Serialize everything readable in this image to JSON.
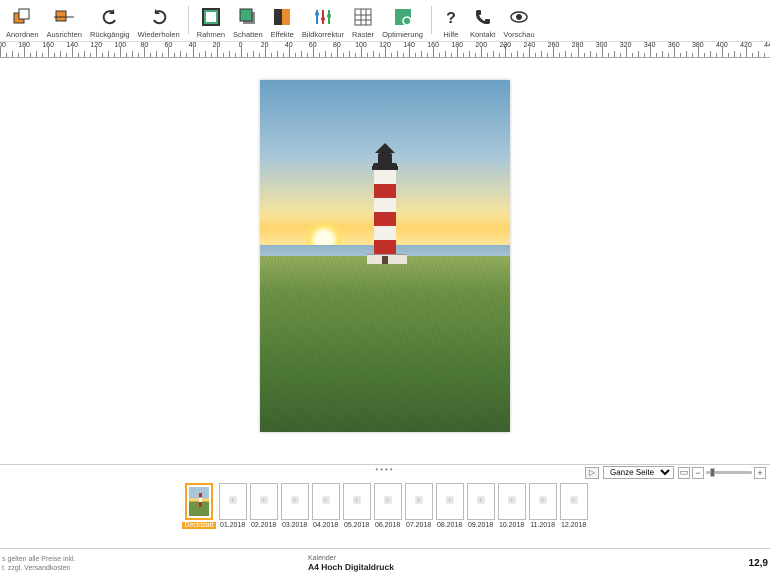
{
  "toolbar": {
    "items": [
      {
        "id": "anordnen",
        "label": "Anordnen",
        "icon": "arrange-icon",
        "color": "#e98b2e"
      },
      {
        "id": "ausrichten",
        "label": "Ausrichten",
        "icon": "align-icon",
        "color": "#e98b2e"
      },
      {
        "id": "rueckgaengig",
        "label": "Rückgängig",
        "icon": "undo-icon",
        "color": "#333"
      },
      {
        "id": "wiederholen",
        "label": "Wiederholen",
        "icon": "redo-icon",
        "color": "#333",
        "sep_after": true
      },
      {
        "id": "rahmen",
        "label": "Rahmen",
        "icon": "frame-icon",
        "color": "#333"
      },
      {
        "id": "schatten",
        "label": "Schatten",
        "icon": "shadow-icon",
        "color": "#333"
      },
      {
        "id": "effekte",
        "label": "Effekte",
        "icon": "effects-icon",
        "color": "#e98b2e"
      },
      {
        "id": "bildkorrektur",
        "label": "Bildkorrektur",
        "icon": "adjust-icon",
        "color": "#3a7"
      },
      {
        "id": "raster",
        "label": "Raster",
        "icon": "grid-icon",
        "color": "#555"
      },
      {
        "id": "optimierung",
        "label": "Optimierung",
        "icon": "optimize-icon",
        "color": "#555",
        "sep_after": true
      },
      {
        "id": "hilfe",
        "label": "Hilfe",
        "icon": "help-icon",
        "color": "#333"
      },
      {
        "id": "kontakt",
        "label": "Kontakt",
        "icon": "phone-icon",
        "color": "#333"
      },
      {
        "id": "vorschau",
        "label": "Vorschau",
        "icon": "eye-icon",
        "color": "#333"
      }
    ]
  },
  "ruler": {
    "start": -200,
    "end": 440,
    "step": 20,
    "cursor_at": 220
  },
  "zoom": {
    "label": "Ganze Seite"
  },
  "months": [
    {
      "label": "Deckblatt",
      "cover": true
    },
    {
      "label": "01.2018"
    },
    {
      "label": "02.2018"
    },
    {
      "label": "03.2018"
    },
    {
      "label": "04.2018"
    },
    {
      "label": "05.2018"
    },
    {
      "label": "06.2018"
    },
    {
      "label": "07.2018"
    },
    {
      "label": "08.2018"
    },
    {
      "label": "09.2018"
    },
    {
      "label": "10.2018"
    },
    {
      "label": "11.2018"
    },
    {
      "label": "12.2018"
    }
  ],
  "status": {
    "legal1": "s gelten alle Preise inkl.",
    "legal2": "t. zzgl. Versandkosten",
    "product_line": "Kalender",
    "product_name": "A4 Hoch Digitaldruck",
    "price": "12,9"
  }
}
